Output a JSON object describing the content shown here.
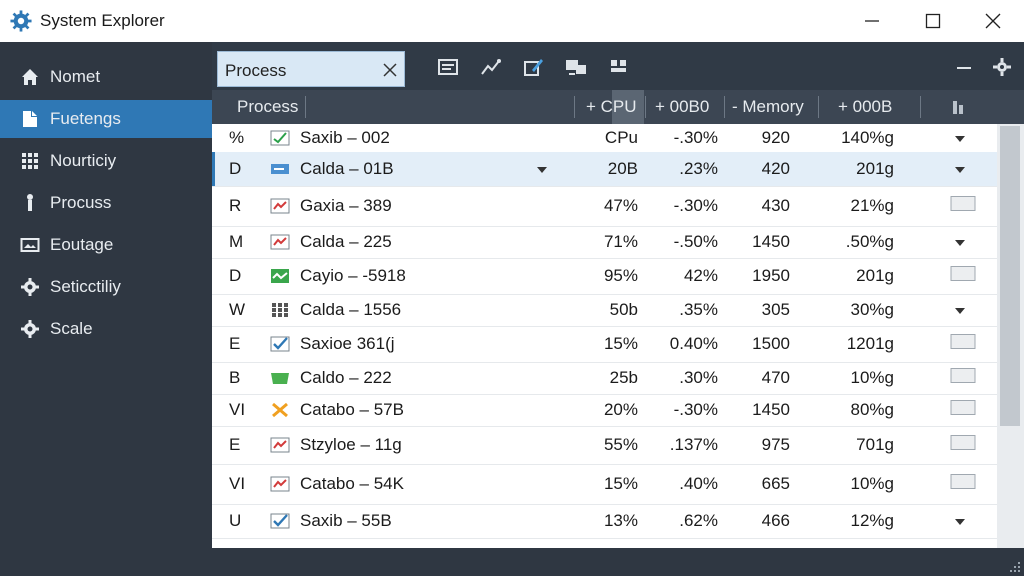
{
  "window": {
    "title": "System Explorer"
  },
  "sidebar": {
    "items": [
      {
        "label": "Nomet",
        "icon": "home-icon"
      },
      {
        "label": "Fuetengs",
        "icon": "document-icon"
      },
      {
        "label": "Nourticiy",
        "icon": "grid-icon"
      },
      {
        "label": "Procuss",
        "icon": "figure-icon"
      },
      {
        "label": "Eoutage",
        "icon": "image-icon"
      },
      {
        "label": "Seticctiliy",
        "icon": "gear-icon"
      },
      {
        "label": "Scale",
        "icon": "gear-icon"
      }
    ],
    "active_index": 1
  },
  "tab": {
    "label": "Process"
  },
  "columns": {
    "process": "Process",
    "cpu": "+ CPU",
    "col3": "+ 00B0",
    "memory": "- Memory",
    "col5": "+ 000B"
  },
  "rows": [
    {
      "letter": "%",
      "icon": "check",
      "name": "Saxib – 002",
      "cpu": "CPu",
      "p2": "-.30%",
      "mem": "920",
      "b": "140%g",
      "action": "dropdown"
    },
    {
      "letter": "D",
      "icon": "bar",
      "name": "Calda – 01B",
      "cpu": "20B",
      "p2": ".23%",
      "mem": "420",
      "b": "201g",
      "action": "dropdown",
      "selected": true
    },
    {
      "letter": "R",
      "icon": "chart",
      "name": "Gaxia – 389",
      "cpu": "47%",
      "p2": "-.30%",
      "mem": "430",
      "b": "21%g",
      "action": "checkbox"
    },
    {
      "letter": "M",
      "icon": "chart",
      "name": "Calda – 225",
      "cpu": "71%",
      "p2": "-.50%",
      "mem": "1450",
      "b": ".50%g",
      "action": "dropdown"
    },
    {
      "letter": "D",
      "icon": "wave",
      "name": "Cayio – -5918",
      "cpu": "95%",
      "p2": "42%",
      "mem": "1950",
      "b": "201g",
      "action": "checkbox"
    },
    {
      "letter": "W",
      "icon": "grid",
      "name": "Calda – 1556",
      "cpu": "50b",
      "p2": ".35%",
      "mem": "305",
      "b": "30%g",
      "action": "dropdown"
    },
    {
      "letter": "E",
      "icon": "check2",
      "name": "Saxioe 361(j",
      "cpu": "15%",
      "p2": "0.40%",
      "mem": "1500",
      "b": "1201g",
      "action": "checkbox"
    },
    {
      "letter": "B",
      "icon": "green",
      "name": "Caldo – 222",
      "cpu": "25b",
      "p2": ".30%",
      "mem": "470",
      "b": "10%g",
      "action": "checkbox"
    },
    {
      "letter": "VI",
      "icon": "x",
      "name": "Catabo – 57B",
      "cpu": "20%",
      "p2": "-.30%",
      "mem": "1450",
      "b": "80%g",
      "action": "checkbox"
    },
    {
      "letter": "E",
      "icon": "chart",
      "name": "Stzyloe – 11g",
      "cpu": "55%",
      "p2": ".137%",
      "mem": "975",
      "b": "701g",
      "action": "checkbox"
    },
    {
      "letter": "VI",
      "icon": "chart",
      "name": "Catabo – 54K",
      "cpu": "15%",
      "p2": ".40%",
      "mem": "665",
      "b": "10%g",
      "action": "checkbox"
    },
    {
      "letter": "U",
      "icon": "check2",
      "name": "Saxib – 55B",
      "cpu": "13%",
      "p2": ".62%",
      "mem": "466",
      "b": "12%g",
      "action": "dropdown"
    }
  ],
  "colors": {
    "sidebar": "#2f3742",
    "accent": "#2f78b5",
    "header": "#3c4653"
  }
}
